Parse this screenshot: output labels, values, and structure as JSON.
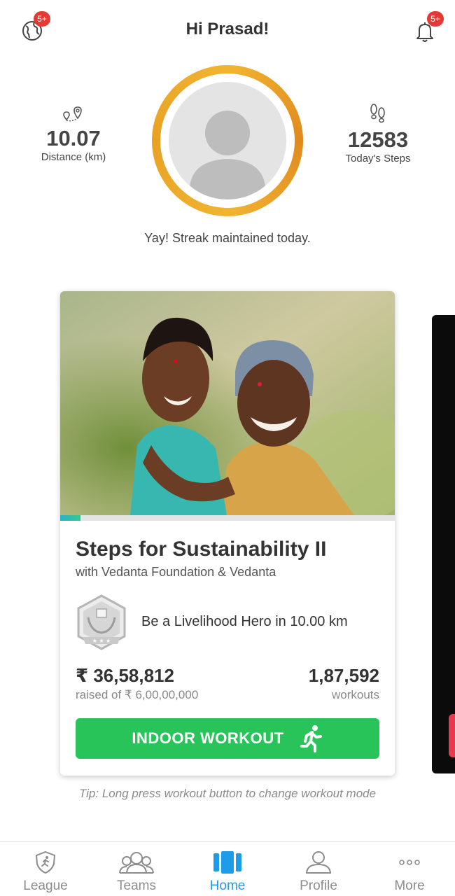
{
  "header": {
    "title": "Hi Prasad!",
    "left_badge": "5+",
    "right_badge": "5+"
  },
  "stats": {
    "distance_value": "10.07",
    "distance_label": "Distance (km)",
    "steps_value": "12583",
    "steps_label": "Today's Steps"
  },
  "streak_text": "Yay! Streak maintained today.",
  "card": {
    "title": "Steps for Sustainability II",
    "subtitle": "with Vedanta Foundation & Vedanta",
    "progress_fraction": 0.06,
    "goal_text": "Be a Livelihood Hero in 10.00 km",
    "raised_amount": "₹ 36,58,812",
    "raised_sub": "raised of ₹ 6,00,00,000",
    "workouts_count": "1,87,592",
    "workouts_label": "workouts",
    "button_label": "INDOOR WORKOUT"
  },
  "tip": "Tip: Long press workout button to change workout mode",
  "nav": {
    "items": [
      {
        "label": "League",
        "icon": "shield-runner-icon"
      },
      {
        "label": "Teams",
        "icon": "group-icon"
      },
      {
        "label": "Home",
        "icon": "columns-icon"
      },
      {
        "label": "Profile",
        "icon": "person-icon"
      },
      {
        "label": "More",
        "icon": "more-dots-icon"
      }
    ],
    "active": "Home"
  },
  "colors": {
    "accent_blue": "#1e9ce9",
    "button_green": "#28c459",
    "ring_orange": "#e8a124",
    "badge_red": "#e53935"
  }
}
